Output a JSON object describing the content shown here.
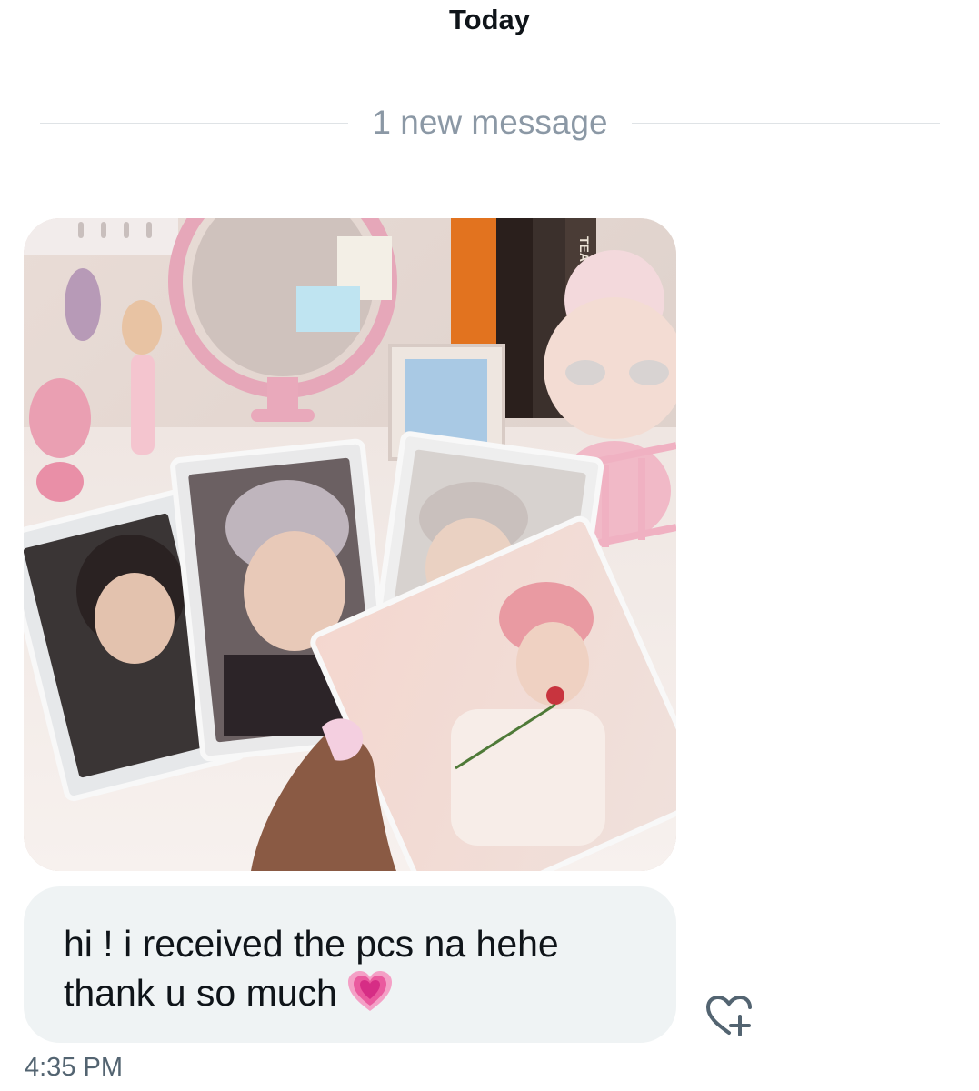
{
  "conversation": {
    "date_header": "Today",
    "new_messages_label": "1 new message"
  },
  "message": {
    "line1": "hi ! i received the pcs na hehe",
    "line2": "thank u so much",
    "emoji": "growing-heart-emoji",
    "timestamp": "4:35 PM",
    "media": {
      "description_icon": "photo-attachment",
      "book_spine_text": "TEACH"
    }
  },
  "actions": {
    "react_icon": "heart-plus-icon"
  },
  "colors": {
    "bubble_bg": "#eff3f4",
    "text": "#0f1419",
    "muted": "#536471",
    "divider_text": "#8b98a5"
  }
}
